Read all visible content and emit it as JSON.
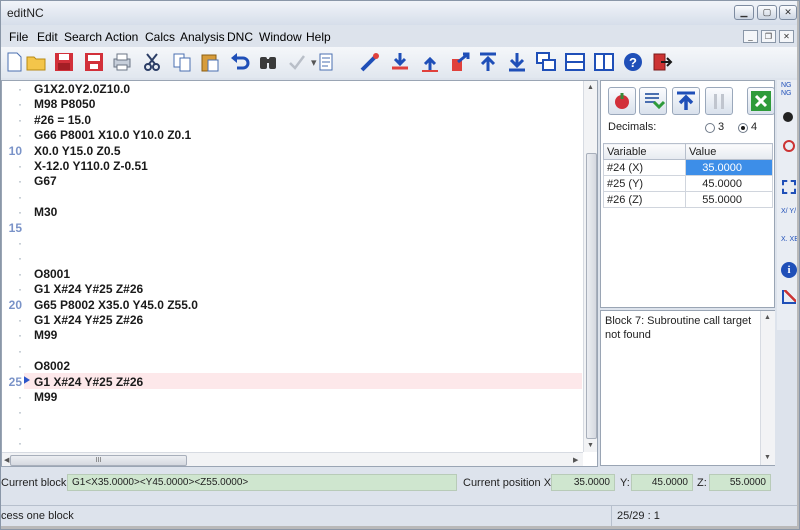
{
  "window": {
    "title": "editNC"
  },
  "menu": [
    "File",
    "Edit",
    "Search",
    "Action",
    "Calcs",
    "Analysis",
    "DNC",
    "Window",
    "Help"
  ],
  "toolbar_icons": [
    "new-file-icon",
    "open-folder-icon",
    "save-icon",
    "save-as-icon",
    "print-icon",
    "cut-icon",
    "copy-icon",
    "paste-icon",
    "undo-icon",
    "find-icon",
    "check-icon",
    "format-icon",
    "tool-icon",
    "download-icon",
    "upload-icon",
    "send-icon",
    "top-icon",
    "bottom-icon",
    "cascade-icon",
    "tile-horizontal-icon",
    "tile-vertical-icon",
    "help-icon",
    "exit-icon"
  ],
  "editor": {
    "lines": [
      {
        "gutter": "·",
        "code": "G1X2.0Y2.0Z10.0"
      },
      {
        "gutter": "·",
        "code": "M98 P8050"
      },
      {
        "gutter": "·",
        "code": "#26 = 15.0"
      },
      {
        "gutter": "·",
        "code": "G66 P8001 X10.0 Y10.0 Z0.1"
      },
      {
        "gutter": "10",
        "code": "X0.0 Y15.0 Z0.5"
      },
      {
        "gutter": "·",
        "code": "X-12.0 Y110.0 Z-0.51"
      },
      {
        "gutter": "·",
        "code": "G67"
      },
      {
        "gutter": "·",
        "code": ""
      },
      {
        "gutter": "·",
        "code": "M30"
      },
      {
        "gutter": "15",
        "code": ""
      },
      {
        "gutter": "·",
        "code": ""
      },
      {
        "gutter": "·",
        "code": ""
      },
      {
        "gutter": "·",
        "code": "O8001"
      },
      {
        "gutter": "·",
        "code": "G1 X#24 Y#25 Z#26"
      },
      {
        "gutter": "20",
        "code": "G65 P8002 X35.0 Y45.0 Z55.0"
      },
      {
        "gutter": "·",
        "code": "G1 X#24 Y#25 Z#26"
      },
      {
        "gutter": "·",
        "code": "M99"
      },
      {
        "gutter": "·",
        "code": ""
      },
      {
        "gutter": "·",
        "code": "O8002"
      },
      {
        "gutter": "25",
        "code": "G1 X#24 Y#25 Z#26"
      },
      {
        "gutter": "·",
        "code": "M99"
      },
      {
        "gutter": "·",
        "code": ""
      },
      {
        "gutter": "·",
        "code": ""
      },
      {
        "gutter": "·",
        "code": ""
      }
    ],
    "hscroll_grip": "III"
  },
  "panel": {
    "buttons": [
      "stop-icon",
      "step-icon",
      "run-top-icon",
      "pause-icon",
      "close-panel-icon"
    ],
    "decimals_label": "Decimals:",
    "decimals_options": [
      "3",
      "4"
    ],
    "decimals_selected": "4",
    "table_headers": [
      "Variable",
      "Value"
    ],
    "table_rows": [
      {
        "variable": "#24 (X)",
        "value": "35.0000"
      },
      {
        "variable": "#25 (Y)",
        "value": "45.0000"
      },
      {
        "variable": "#26 (Z)",
        "value": "55.0000"
      }
    ],
    "message": "Block 7: Subroutine call target not found"
  },
  "sidebar_labels": [
    "NG NG",
    "X/ Y/",
    "X. XB"
  ],
  "current_block": {
    "label": "Current block:",
    "value": "G1<X35.0000><Y45.0000><Z55.0000>",
    "position_label": "Current position X:",
    "x": "35.0000",
    "y_label": "Y:",
    "y": "45.0000",
    "z_label": "Z:",
    "z": "55.0000"
  },
  "status": {
    "message": "cess one block",
    "position": "25/29 : 1"
  },
  "colors": {
    "accent": "#3d8ee8",
    "current_line": "#fde8ea",
    "field_green": "#cfe6cf"
  }
}
